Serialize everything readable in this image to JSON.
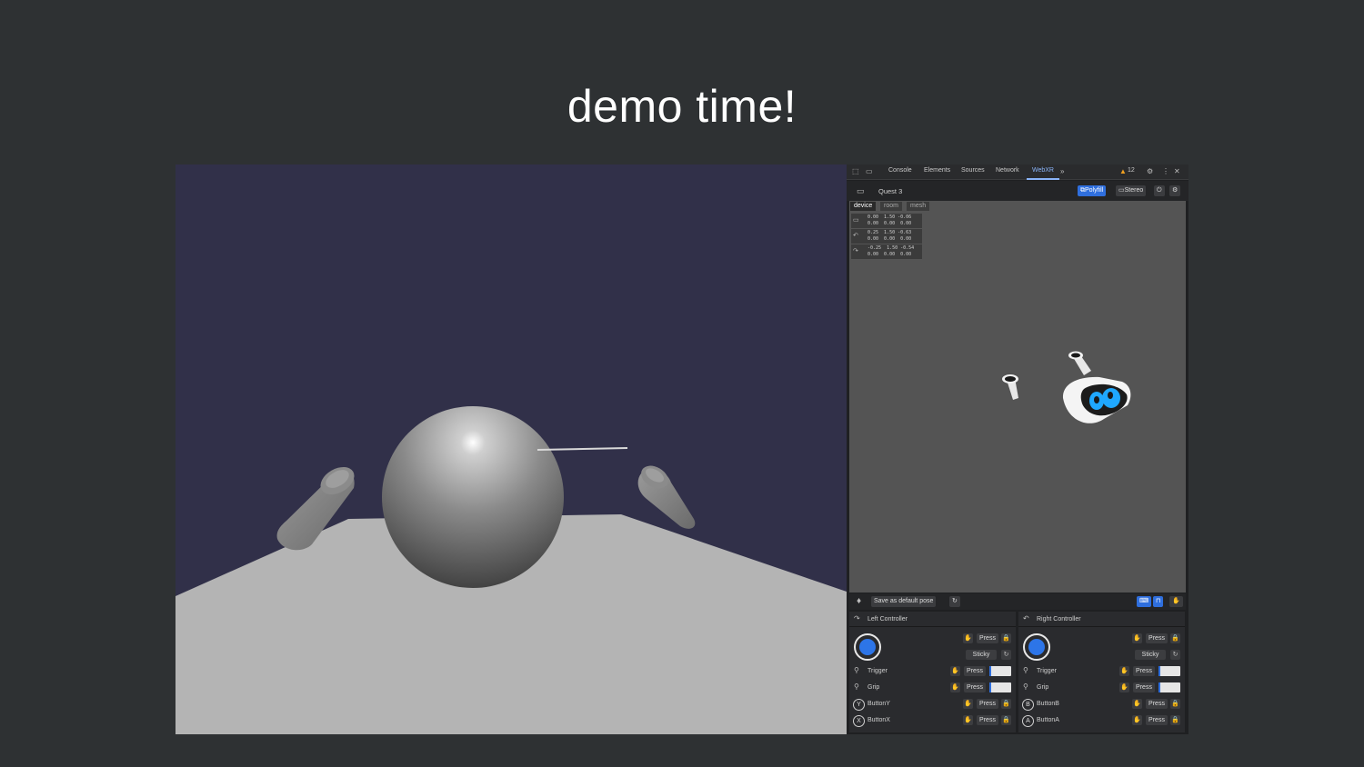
{
  "slide": {
    "title": "demo time!"
  },
  "devtools": {
    "tabs": [
      "Console",
      "Elements",
      "Sources",
      "Network",
      "WebXR"
    ],
    "active_tab": "WebXR",
    "more_tabs_icon": "chevron-double-right-icon",
    "warning_count": "12",
    "device_name": "Quest 3",
    "polyfill_label": "Polyfill",
    "stereo_label": "Stereo",
    "view_tabs": [
      "device",
      "room",
      "mesh"
    ],
    "poses": [
      {
        "line1": "0.00  1.50 -0.06",
        "line2": "0.00  0.00  0.00"
      },
      {
        "line1": "0.25  1.50 -0.63",
        "line2": "0.00  0.00  0.00"
      },
      {
        "line1": "-0.25  1.50 -0.54",
        "line2": "0.00  0.00  0.00"
      }
    ],
    "save_pose_label": "Save as default pose",
    "left_controller": {
      "title": "Left Controller",
      "press": "Press",
      "sticky": "Sticky",
      "trigger": "Trigger",
      "grip": "Grip",
      "button_top": "ButtonY",
      "button_top_letter": "Y",
      "button_bottom": "ButtonX",
      "button_bottom_letter": "X"
    },
    "right_controller": {
      "title": "Right Controller",
      "press": "Press",
      "sticky": "Sticky",
      "trigger": "Trigger",
      "grip": "Grip",
      "button_top": "ButtonB",
      "button_top_letter": "B",
      "button_bottom": "ButtonA",
      "button_bottom_letter": "A"
    },
    "trigger_value": 0.1,
    "grip_value": 0.1,
    "colors": {
      "accent": "#2f6fde",
      "scene_bg": "#313049"
    }
  }
}
